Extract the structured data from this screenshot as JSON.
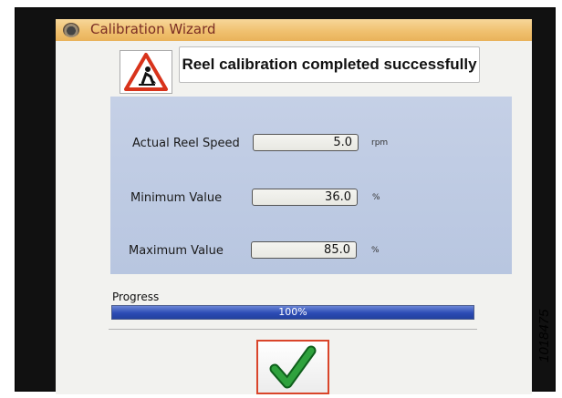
{
  "window": {
    "title": "Calibration Wizard",
    "icon": "app-logo-icon"
  },
  "message": {
    "icon": "warning-worker-icon",
    "text": "Reel calibration completed successfully"
  },
  "values": [
    {
      "label": "Actual Reel Speed",
      "value": "5.0",
      "unit": "rpm"
    },
    {
      "label": "Minimum Value",
      "value": "36.0",
      "unit": "%"
    },
    {
      "label": "Maximum Value",
      "value": "85.0",
      "unit": "%"
    }
  ],
  "progress": {
    "label": "Progress",
    "percent": 100,
    "text": "100%"
  },
  "ok_button": {
    "icon": "checkmark-icon"
  },
  "figure_number": "1018475",
  "colors": {
    "accent_border": "#d9452a",
    "check_green": "#1f8f2c",
    "progress_blue": "#2c4bb5",
    "title_bar": "#f0c170"
  }
}
